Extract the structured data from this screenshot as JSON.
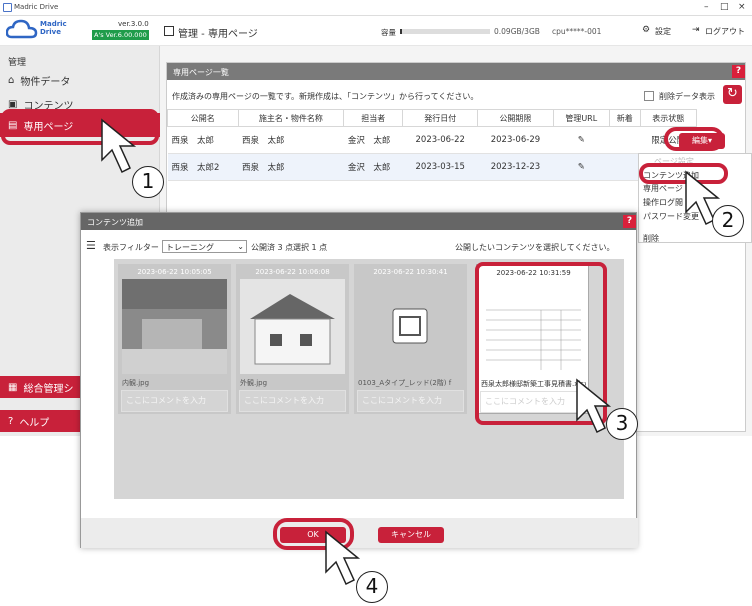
{
  "window": {
    "title": "Madric Drive",
    "controls": [
      "–",
      "□",
      "×"
    ]
  },
  "header": {
    "logo_text": "Madric\nDrive",
    "version": "ver.3.0.0",
    "as_version": "A's Ver.6.00.000",
    "page_title": "管理 - 専用ページ",
    "capacity_label": "容量",
    "capacity_value": "0.09GB/3GB",
    "cpu_label": "cpu*****-001",
    "settings": "設定",
    "logout": "ログアウト"
  },
  "sidebar": {
    "section": "管理",
    "items": [
      {
        "label": "物件データ"
      },
      {
        "label": "コンテンツ"
      },
      {
        "label": "専用ページ"
      }
    ],
    "bottom": [
      {
        "label": "総合管理シ"
      },
      {
        "label": "ヘルプ"
      }
    ]
  },
  "main": {
    "panel_title": "専用ページ一覧",
    "help": "?",
    "description": "作成済みの専用ページの一覧です。新規作成は、「コンテンツ」から行ってください。",
    "deleted_toggle": "削除データ表示",
    "columns": [
      "公開名",
      "施主名・物件名称",
      "担当者",
      "発行日付",
      "公開期限",
      "管理URL",
      "新着",
      "表示状態"
    ],
    "rows": [
      {
        "name": "西泉　太郎",
        "owner": "西泉　太郎",
        "staff": "金沢　太郎",
        "issued": "2023-06-22",
        "expires": "2023-06-29",
        "status": "限定公開",
        "action": "編集▾"
      },
      {
        "name": "西泉　太郎2",
        "owner": "西泉　太郎",
        "staff": "金沢　太郎",
        "issued": "2023-03-15",
        "expires": "2023-12-23",
        "status": "公",
        "action": ""
      }
    ]
  },
  "dropdown": {
    "items": [
      "ページ設定",
      "コンテンツ追加",
      "専用ページ",
      "操作ログ閲",
      "パスワード変更",
      "削除"
    ]
  },
  "dialog": {
    "title": "コンテンツ追加",
    "help": "?",
    "filter_label": "表示フィルター",
    "filter_value": "トレーニング",
    "published": "公開済 3 点",
    "selected": "選択 1 点",
    "instruction": "公開したいコンテンツを選択してください。",
    "cards": [
      {
        "timestamp": "2023-06-22 10:05:05",
        "filename": "内観.jpg",
        "comment_placeholder": "ここにコメントを入力"
      },
      {
        "timestamp": "2023-06-22 10:06:08",
        "filename": "外観.jpg",
        "comment_placeholder": "ここにコメントを入力"
      },
      {
        "timestamp": "2023-06-22 10:30:41",
        "filename": "0103_Aタイプ_レッド(2階) f",
        "comment_placeholder": "ここにコメントを入力"
      },
      {
        "timestamp": "2023-06-22 10:31:59",
        "filename": "西泉太郎様邸新築工事見積書.xlsx",
        "comment_placeholder": "ここにコメントを入力"
      }
    ],
    "ok": "OK",
    "cancel": "キャンセル"
  },
  "callouts": [
    "1",
    "2",
    "3",
    "4"
  ],
  "colors": {
    "accent": "#c8213a",
    "header_gray": "#7a7a7a"
  }
}
